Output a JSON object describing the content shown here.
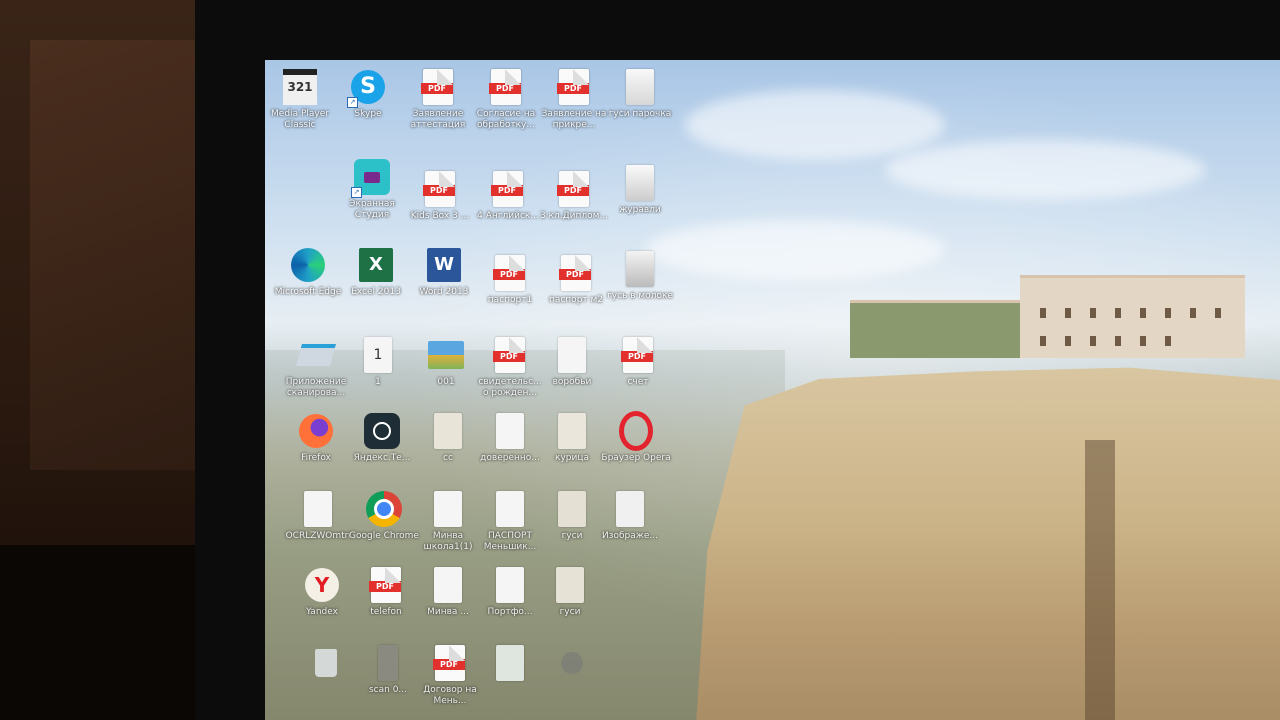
{
  "desktop": {
    "icons": [
      {
        "label": "Media Player Classic"
      },
      {
        "label": "Skype"
      },
      {
        "label": "Заявление аттестация"
      },
      {
        "label": "Согласие на обработку..."
      },
      {
        "label": "Заявление на прикре..."
      },
      {
        "label": "гуси парочка"
      },
      {
        "label": "Экранная Студия"
      },
      {
        "label": "Kids Box 3 ..."
      },
      {
        "label": "4 Английск..."
      },
      {
        "label": "3 кл.Диплом..."
      },
      {
        "label": "журавли"
      },
      {
        "label": "Microsoft Edge"
      },
      {
        "label": "Excel 2013"
      },
      {
        "label": "Word 2013"
      },
      {
        "label": "паспорт1"
      },
      {
        "label": "паспорт м2"
      },
      {
        "label": "гусь в молоке"
      },
      {
        "label": "Приложение сканирова..."
      },
      {
        "label": "1"
      },
      {
        "label": "001"
      },
      {
        "label": "свидетельс... о рожден..."
      },
      {
        "label": "воробьи"
      },
      {
        "label": "счет"
      },
      {
        "label": "Firefox"
      },
      {
        "label": "Яндекс.Те..."
      },
      {
        "label": "сс"
      },
      {
        "label": "доверенно..."
      },
      {
        "label": "курица"
      },
      {
        "label": "Браузер Opera"
      },
      {
        "label": "OCRLZWOmtn"
      },
      {
        "label": "Google Chrome"
      },
      {
        "label": "Минва школа1(1)"
      },
      {
        "label": "ПАСПОРТ Меньшик..."
      },
      {
        "label": "гуси"
      },
      {
        "label": "Изображе..."
      },
      {
        "label": "Yandex"
      },
      {
        "label": "telefon"
      },
      {
        "label": "Минва ..."
      },
      {
        "label": "Портфо..."
      },
      {
        "label": "гуси"
      },
      {
        "label": ""
      },
      {
        "label": "scan 0..."
      },
      {
        "label": "Договор на Мень..."
      },
      {
        "label": ""
      },
      {
        "label": ""
      }
    ]
  },
  "icon_types": {
    "pdf_badge": "PDF",
    "excel_letter": "X",
    "word_letter": "W",
    "skype_letter": "S",
    "mpc_number": "321",
    "doc1_number": "1"
  },
  "colors": {
    "pdf_red": "#e2302c",
    "skype_blue": "#1aa3e8",
    "excel_green": "#1e7145",
    "word_blue": "#2b579a",
    "edge_teal": "#1fa0c8"
  }
}
